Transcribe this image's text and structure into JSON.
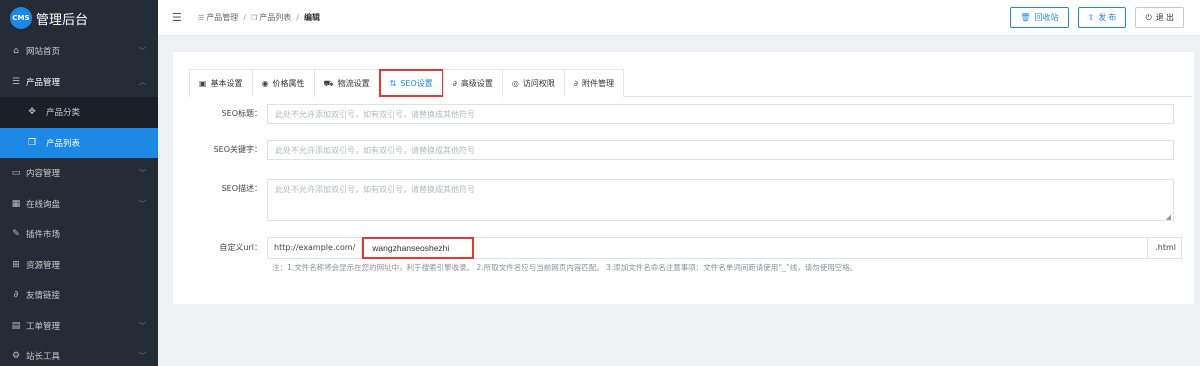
{
  "app": {
    "logo_badge": "CMS",
    "title": "管理后台"
  },
  "sidebar": {
    "items": [
      {
        "label": "网站首页",
        "icon": "home-icon",
        "chevron": "﹀"
      },
      {
        "label": "产品管理",
        "icon": "list-icon",
        "chevron": "︿"
      },
      {
        "label": "产品分类",
        "icon": "tags-icon"
      },
      {
        "label": "产品列表",
        "icon": "copy-icon"
      },
      {
        "label": "内容管理",
        "icon": "keyboard-icon",
        "chevron": "﹀"
      },
      {
        "label": "在线询盘",
        "icon": "table-icon",
        "chevron": "﹀"
      },
      {
        "label": "插件市场",
        "icon": "pin-icon"
      },
      {
        "label": "资源管理",
        "icon": "grid-icon"
      },
      {
        "label": "友情链接",
        "icon": "link-icon"
      },
      {
        "label": "工单管理",
        "icon": "form-icon",
        "chevron": "﹀"
      },
      {
        "label": "站长工具",
        "icon": "gears-icon",
        "chevron": "﹀"
      }
    ]
  },
  "breadcrumb": {
    "items": [
      "产品管理",
      "产品列表",
      "编辑"
    ],
    "separator": "/"
  },
  "toolbar": {
    "recycle_label": "回收站",
    "publish_label": "发 布",
    "logout_label": "退 出"
  },
  "tabs": [
    {
      "label": "基本设置",
      "icon": "doc-icon"
    },
    {
      "label": "价格属性",
      "icon": "coin-icon"
    },
    {
      "label": "物流设置",
      "icon": "truck-icon"
    },
    {
      "label": "SEO设置",
      "icon": "sort-icon",
      "active": true
    },
    {
      "label": "高级设置",
      "icon": "link-icon"
    },
    {
      "label": "访问权限",
      "icon": "eye-icon"
    },
    {
      "label": "附件管理",
      "icon": "paperclip-icon"
    }
  ],
  "form": {
    "seo_title": {
      "label": "SEO标题：",
      "placeholder": "此处不允许添加双引号，如有双引号，请替换成其他符号",
      "value": ""
    },
    "seo_keywords": {
      "label": "SEO关键字：",
      "placeholder": "此处不允许添加双引号，如有双引号，请替换成其他符号",
      "value": ""
    },
    "seo_description": {
      "label": "SEO描述：",
      "placeholder": "此处不允许添加双引号，如有双引号，请替换成其他符号",
      "value": ""
    },
    "custom_url": {
      "label": "自定义url：",
      "prefix": "http://example.com/",
      "value": "wangzhanseoshezhi",
      "suffix": ".html"
    },
    "hint": "注：1.文件名称将会显示在您的网址中，利于搜索引擎收录。 2.所取文件名应与当前网页内容匹配。 3.添加文件名命名注意事项：文件名单词间距请使用“_”线，请勿使用空格。"
  },
  "colors": {
    "sidebar_bg": "#252c37",
    "accent": "#1e88e5",
    "highlight_box": "#e53935"
  }
}
